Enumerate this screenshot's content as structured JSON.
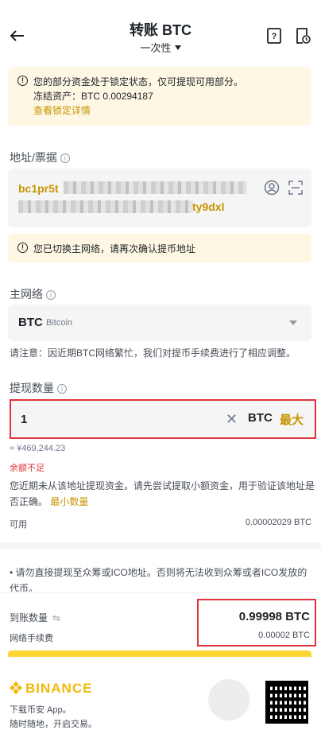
{
  "header": {
    "title": "转账 BTC",
    "mode": "一次性",
    "back_icon": "arrow-left-icon",
    "help_icon": "help-book-icon",
    "history_icon": "history-doc-icon"
  },
  "lock_notice": {
    "line1": "您的部分资金处于锁定状态，仅可提现可用部分。",
    "frozen_label": "冻结资产：",
    "frozen_value": "BTC 0.00294187",
    "link": "查看锁定详情"
  },
  "address": {
    "label": "地址/票据",
    "prefix": "bc1pr5t",
    "suffix": "ty9dxl",
    "contact_icon": "address-book-icon",
    "scan_icon": "scan-icon"
  },
  "network_warning": "您已切换主网络，请再次确认提币地址",
  "network": {
    "label": "主网络",
    "code": "BTC",
    "name": "Bitcoin",
    "note": "请注意：因近期BTC网络繁忙，我们对提币手续费进行了相应调整。"
  },
  "amount": {
    "label": "提现数量",
    "value": "1",
    "unit": "BTC",
    "max_label": "最大",
    "fiat": "≈ ¥469,244.23",
    "error": "余额不足",
    "hint": "您近期未从该地址提现资金。请先尝试提取小额资金，用于验证该地址是否正确。",
    "hint_link": "最小数量",
    "available_label": "可用",
    "available_value": "0.00002029 BTC"
  },
  "ico_note": "• 请勿直接提现至众筹或ICO地址。否则将无法收到众筹或者ICO发放的代币。",
  "summary": {
    "receive_label": "到账数量",
    "receive_value": "0.99998 BTC",
    "fee_label": "网络手续费",
    "fee_value": "0.00002 BTC"
  },
  "footer": {
    "brand": "BINANCE",
    "download": "下载币安 App。",
    "slogan": "随时随地，开启交易。"
  },
  "colors": {
    "accent": "#c99400",
    "brand": "#f0b90b",
    "warning_bg": "#fdf7e3",
    "error": "#e0343a",
    "button": "#fcd535"
  }
}
